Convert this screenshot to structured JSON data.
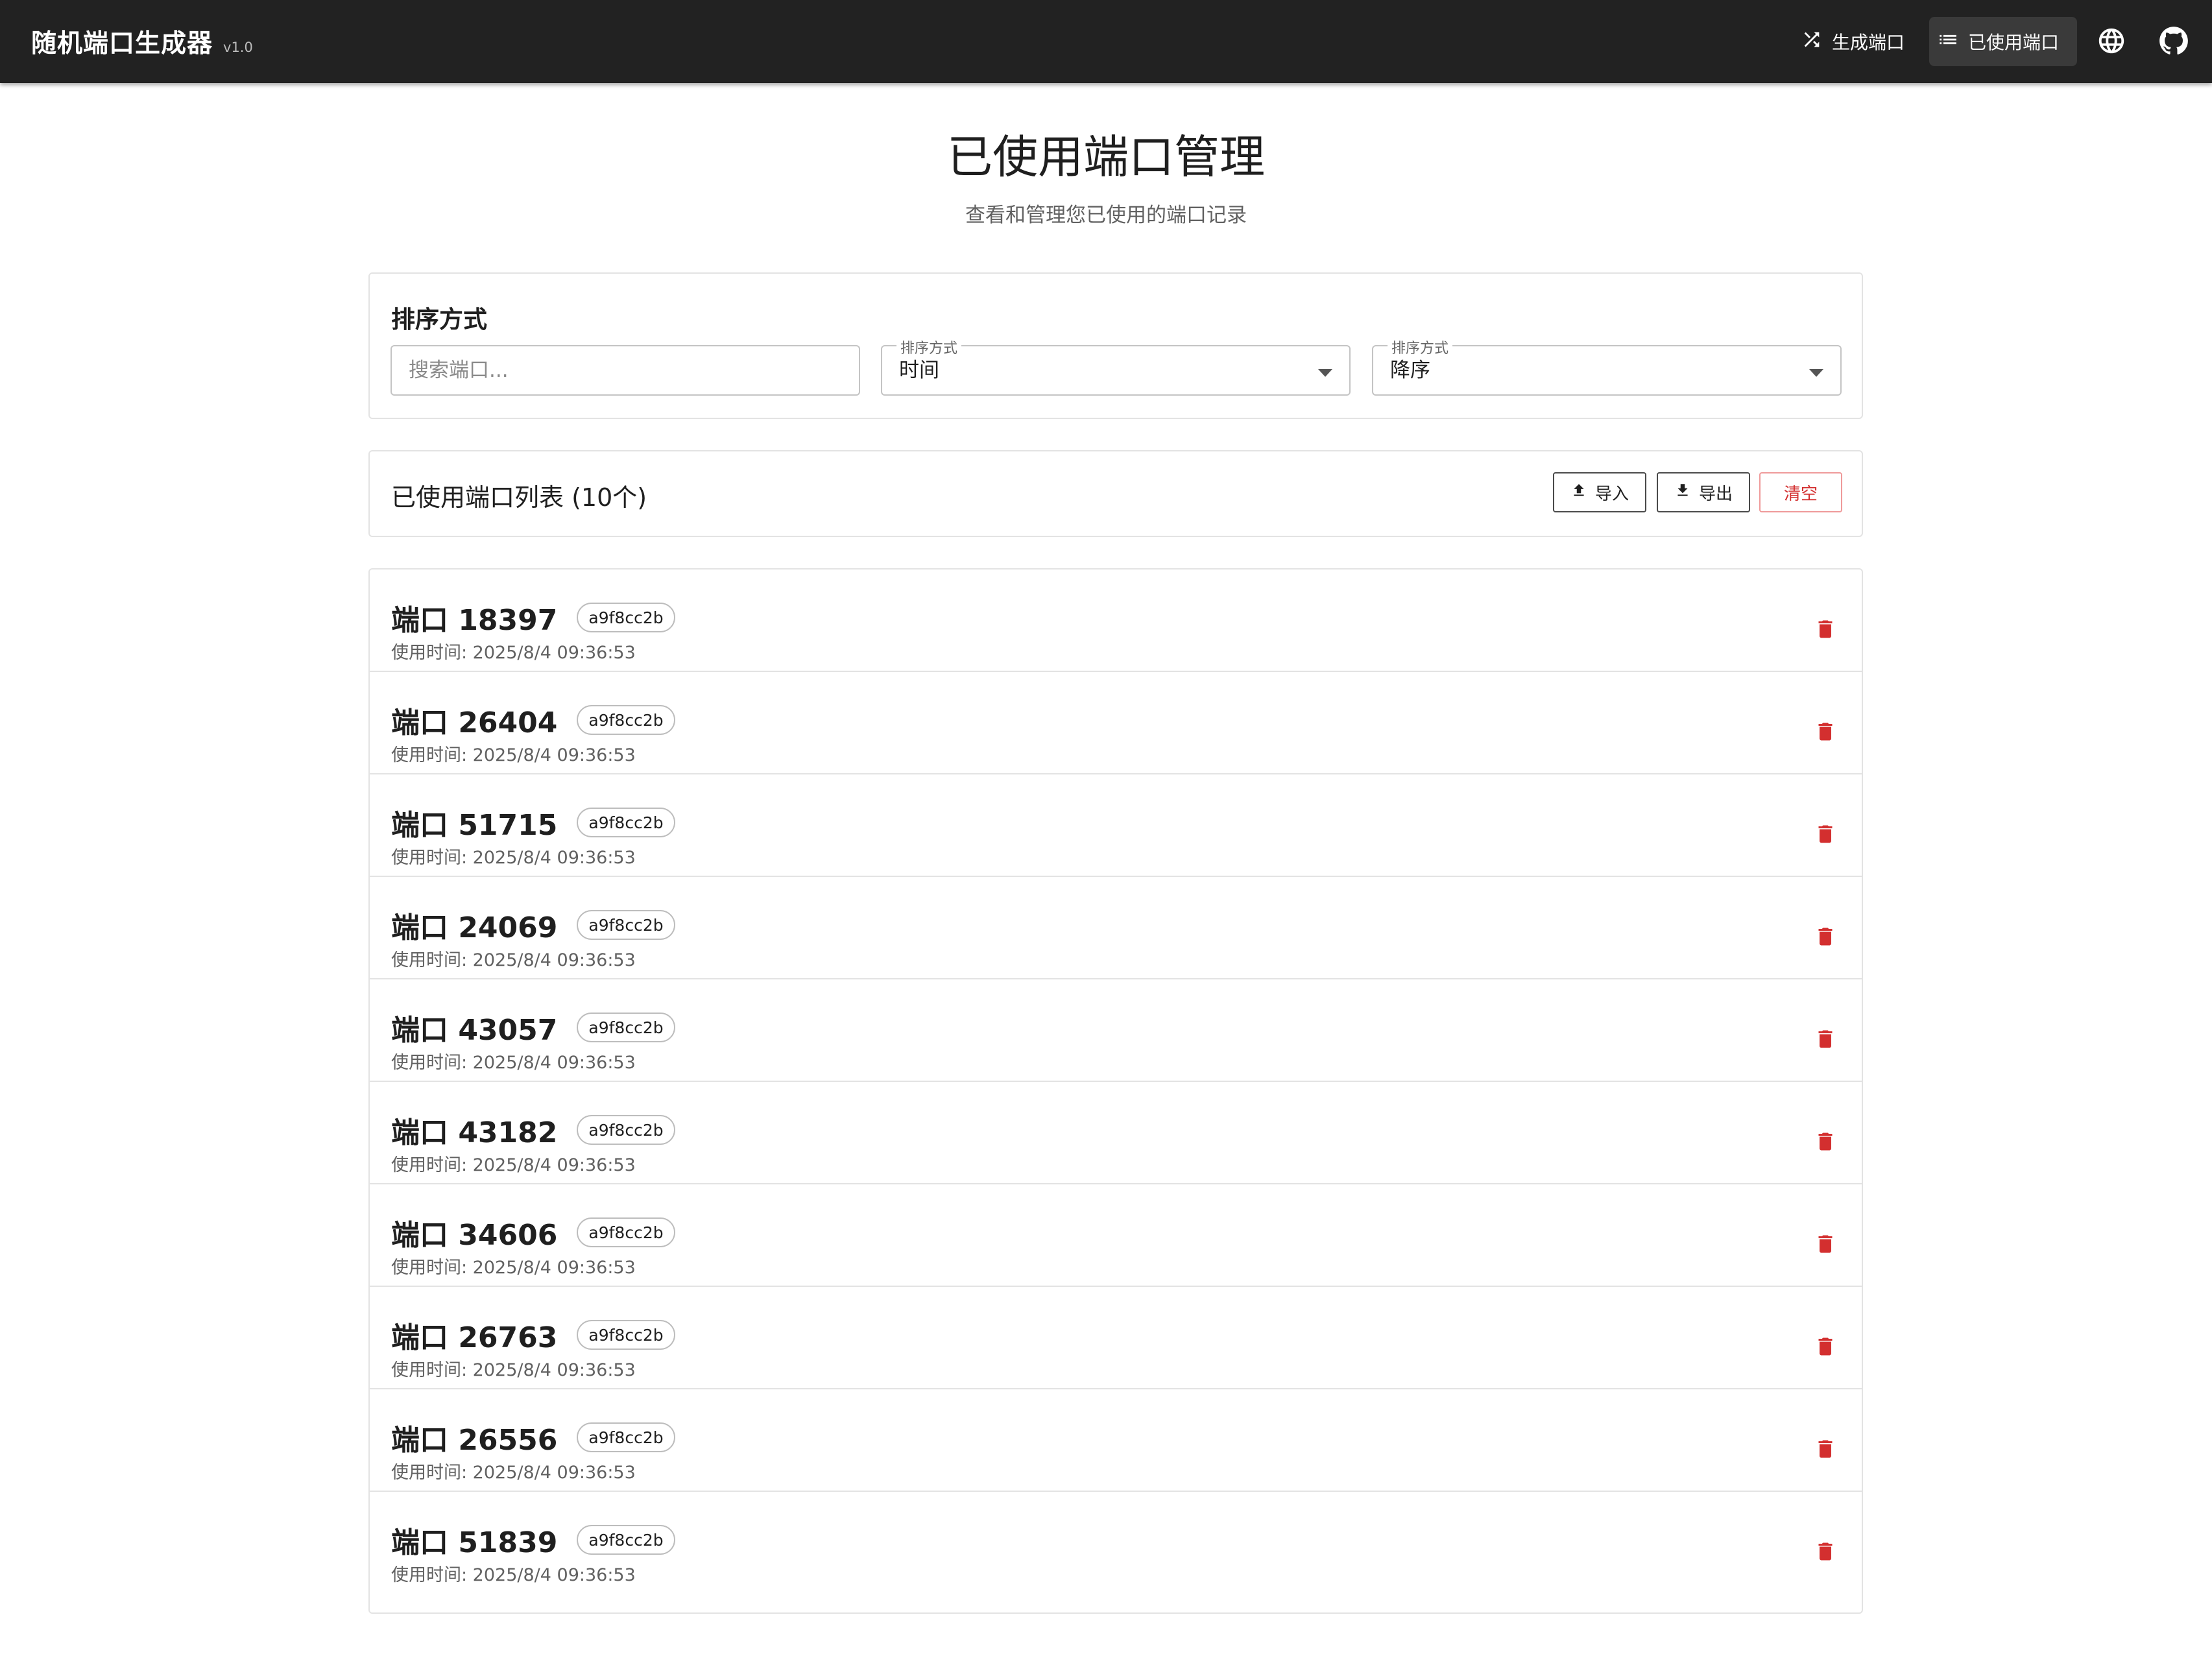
{
  "app": {
    "title": "随机端口生成器",
    "version": "v1.0",
    "nav": {
      "generate_label": "生成端口",
      "used_label": "已使用端口"
    }
  },
  "header": {
    "title": "已使用端口管理",
    "subtitle": "查看和管理您已使用的端口记录"
  },
  "sort": {
    "heading": "排序方式",
    "search_placeholder": "搜索端口...",
    "sort_by_label": "排序方式",
    "sort_by_value": "时间",
    "order_label": "排序方式",
    "order_value": "降序"
  },
  "list": {
    "title": "已使用端口列表 (10个)",
    "import_label": "导入",
    "export_label": "导出",
    "clear_label": "清空",
    "items": [
      {
        "name": "端口 18397",
        "tag": "a9f8cc2b",
        "time": "使用时间: 2025/8/4 09:36:53"
      },
      {
        "name": "端口 26404",
        "tag": "a9f8cc2b",
        "time": "使用时间: 2025/8/4 09:36:53"
      },
      {
        "name": "端口 51715",
        "tag": "a9f8cc2b",
        "time": "使用时间: 2025/8/4 09:36:53"
      },
      {
        "name": "端口 24069",
        "tag": "a9f8cc2b",
        "time": "使用时间: 2025/8/4 09:36:53"
      },
      {
        "name": "端口 43057",
        "tag": "a9f8cc2b",
        "time": "使用时间: 2025/8/4 09:36:53"
      },
      {
        "name": "端口 43182",
        "tag": "a9f8cc2b",
        "time": "使用时间: 2025/8/4 09:36:53"
      },
      {
        "name": "端口 34606",
        "tag": "a9f8cc2b",
        "time": "使用时间: 2025/8/4 09:36:53"
      },
      {
        "name": "端口 26763",
        "tag": "a9f8cc2b",
        "time": "使用时间: 2025/8/4 09:36:53"
      },
      {
        "name": "端口 26556",
        "tag": "a9f8cc2b",
        "time": "使用时间: 2025/8/4 09:36:53"
      },
      {
        "name": "端口 51839",
        "tag": "a9f8cc2b",
        "time": "使用时间: 2025/8/4 09:36:53"
      }
    ]
  },
  "colors": {
    "appbar": "#222222",
    "danger": "#d32f2f",
    "border": "#e3e3e3"
  },
  "icons": [
    "shuffle-icon",
    "list-icon",
    "globe-icon",
    "github-icon",
    "upload-icon",
    "download-icon",
    "trash-icon",
    "dropdown-arrow-icon"
  ]
}
